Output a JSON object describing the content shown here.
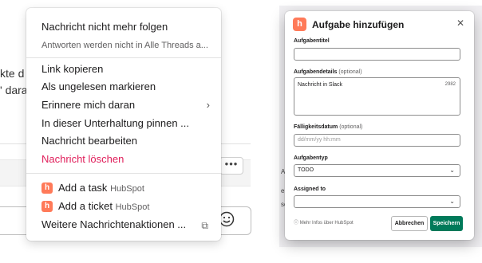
{
  "background": {
    "line1": "kte d",
    "line2": "' dara",
    "more_actions": "•••",
    "emoji_icon": "smiley-icon"
  },
  "menu": {
    "unfollow": {
      "label": "Nachricht nicht mehr folgen",
      "sub": "Antworten werden nicht in Alle Threads a..."
    },
    "copy_link": "Link kopieren",
    "mark_unread": "Als ungelesen markieren",
    "remind": "Erinnere mich daran",
    "pin": "In dieser Unterhaltung pinnen ...",
    "edit": "Nachricht bearbeiten",
    "delete": "Nachricht löschen",
    "add_task": {
      "label": "Add a task",
      "tag": "HubSpot"
    },
    "add_ticket": {
      "label": "Add a ticket",
      "tag": "HubSpot"
    },
    "more": "Weitere Nachrichtenaktionen ...",
    "colors": {
      "danger": "#e01e5a",
      "hubspot": "#ff7a59"
    }
  },
  "modal": {
    "title": "Aufgabe hinzufügen",
    "close_icon": "close-icon",
    "title_field": {
      "label": "Aufgabentitel",
      "value": ""
    },
    "details": {
      "label": "Aufgabendetails",
      "optional": "(optional)",
      "value": "Nachricht in Slack",
      "counter": "2982"
    },
    "due": {
      "label": "Fälligkeitsdatum",
      "optional": "(optional)",
      "placeholder": "dd/mm/yy hh:mm"
    },
    "type": {
      "label": "Aufgabentyp",
      "value": "TODO"
    },
    "assigned": {
      "label": "Assigned to",
      "value": ""
    },
    "info": "Mehr Infos über HubSpot",
    "cancel": "Abbrechen",
    "save": "Speichern",
    "colors": {
      "primary": "#007a5a"
    }
  },
  "right_bg": {
    "stub1": "Aufga",
    "stub2": "e",
    "stub3": "sc"
  }
}
